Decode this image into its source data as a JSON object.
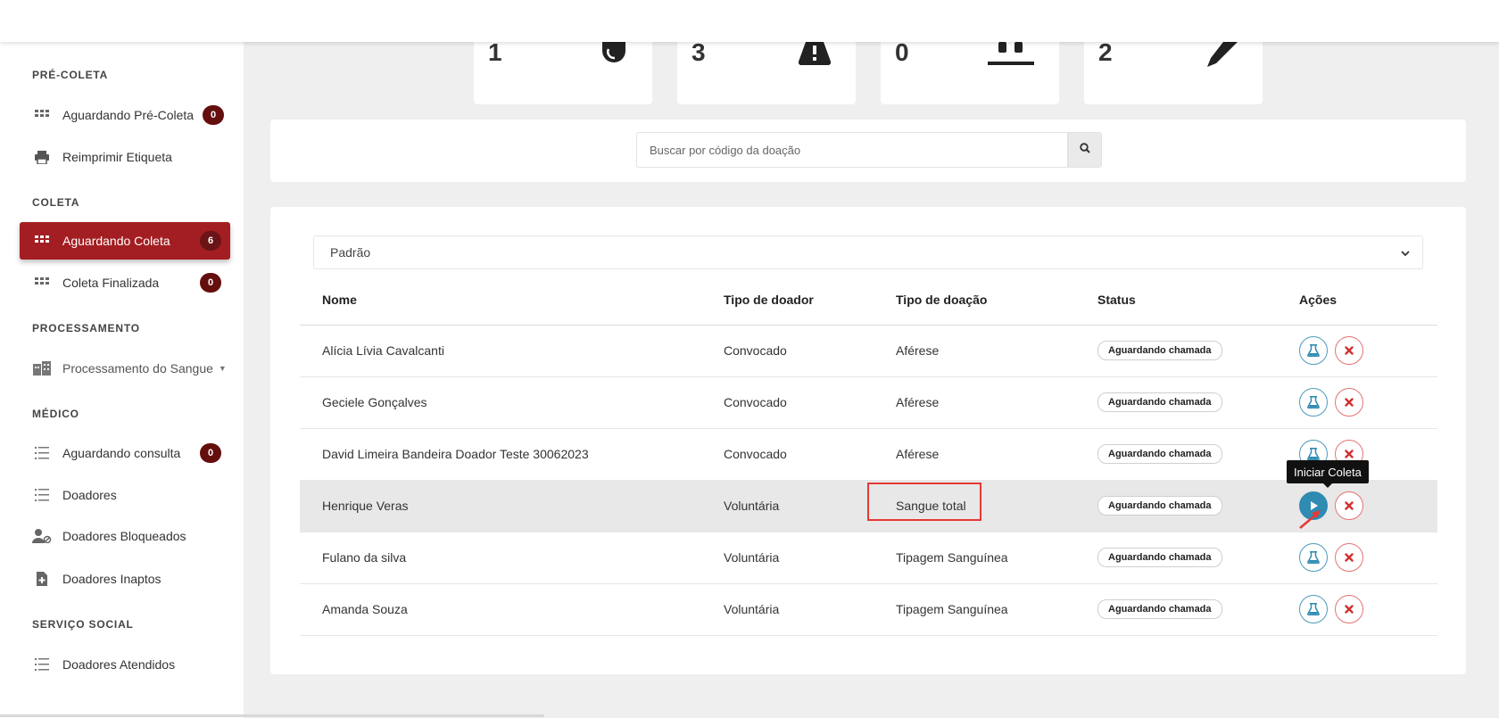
{
  "stats": [
    {
      "value": "1",
      "icon": "drop-icon"
    },
    {
      "value": "3",
      "icon": "warning-icon"
    },
    {
      "value": "0",
      "icon": "bed-icon"
    },
    {
      "value": "2",
      "icon": "syringe-icon"
    }
  ],
  "sidebar": {
    "sections": {
      "pre_coleta": "PRÉ-COLETA",
      "coleta": "COLETA",
      "processamento": "PROCESSAMENTO",
      "medico": "MÉDICO",
      "servico_social": "SERVIÇO SOCIAL"
    },
    "items": {
      "aguardando_pre_coleta": {
        "label": "Aguardando Pré-Coleta",
        "badge": "0"
      },
      "reimprimir_etiqueta": {
        "label": "Reimprimir Etiqueta"
      },
      "aguardando_coleta": {
        "label": "Aguardando Coleta",
        "badge": "6"
      },
      "coleta_finalizada": {
        "label": "Coleta Finalizada",
        "badge": "0"
      },
      "processamento_sangue": {
        "label": "Processamento do Sangue"
      },
      "aguardando_consulta": {
        "label": "Aguardando consulta",
        "badge": "0"
      },
      "doadores": {
        "label": "Doadores"
      },
      "doadores_bloqueados": {
        "label": "Doadores Bloqueados"
      },
      "doadores_inaptos": {
        "label": "Doadores Inaptos"
      },
      "doadores_atendidos": {
        "label": "Doadores Atendidos"
      }
    }
  },
  "search": {
    "placeholder": "Buscar por código da doação"
  },
  "filter": {
    "selected": "Padrão"
  },
  "table": {
    "headers": {
      "nome": "Nome",
      "tipo_doador": "Tipo de doador",
      "tipo_doacao": "Tipo de doação",
      "status": "Status",
      "acoes": "Ações"
    },
    "rows": [
      {
        "nome": "Alícia Lívia Cavalcanti",
        "tipo_doador": "Convocado",
        "tipo_doacao": "Aférese",
        "status": "Aguardando chamada"
      },
      {
        "nome": "Geciele Gonçalves",
        "tipo_doador": "Convocado",
        "tipo_doacao": "Aférese",
        "status": "Aguardando chamada"
      },
      {
        "nome": "David Limeira Bandeira Doador Teste 30062023",
        "tipo_doador": "Convocado",
        "tipo_doacao": "Aférese",
        "status": "Aguardando chamada"
      },
      {
        "nome": "Henrique Veras",
        "tipo_doador": "Voluntária",
        "tipo_doacao": "Sangue total",
        "status": "Aguardando chamada"
      },
      {
        "nome": "Fulano da silva",
        "tipo_doador": "Voluntária",
        "tipo_doacao": "Tipagem Sanguínea",
        "status": "Aguardando chamada"
      },
      {
        "nome": "Amanda Souza",
        "tipo_doador": "Voluntária",
        "tipo_doacao": "Tipagem Sanguínea",
        "status": "Aguardando chamada"
      }
    ]
  },
  "tooltip": {
    "text": "Iniciar Coleta"
  },
  "colors": {
    "accent": "#a31e22",
    "badge": "#650e0e",
    "action_blue": "#2f8bb2",
    "cancel_red": "#e53935"
  }
}
